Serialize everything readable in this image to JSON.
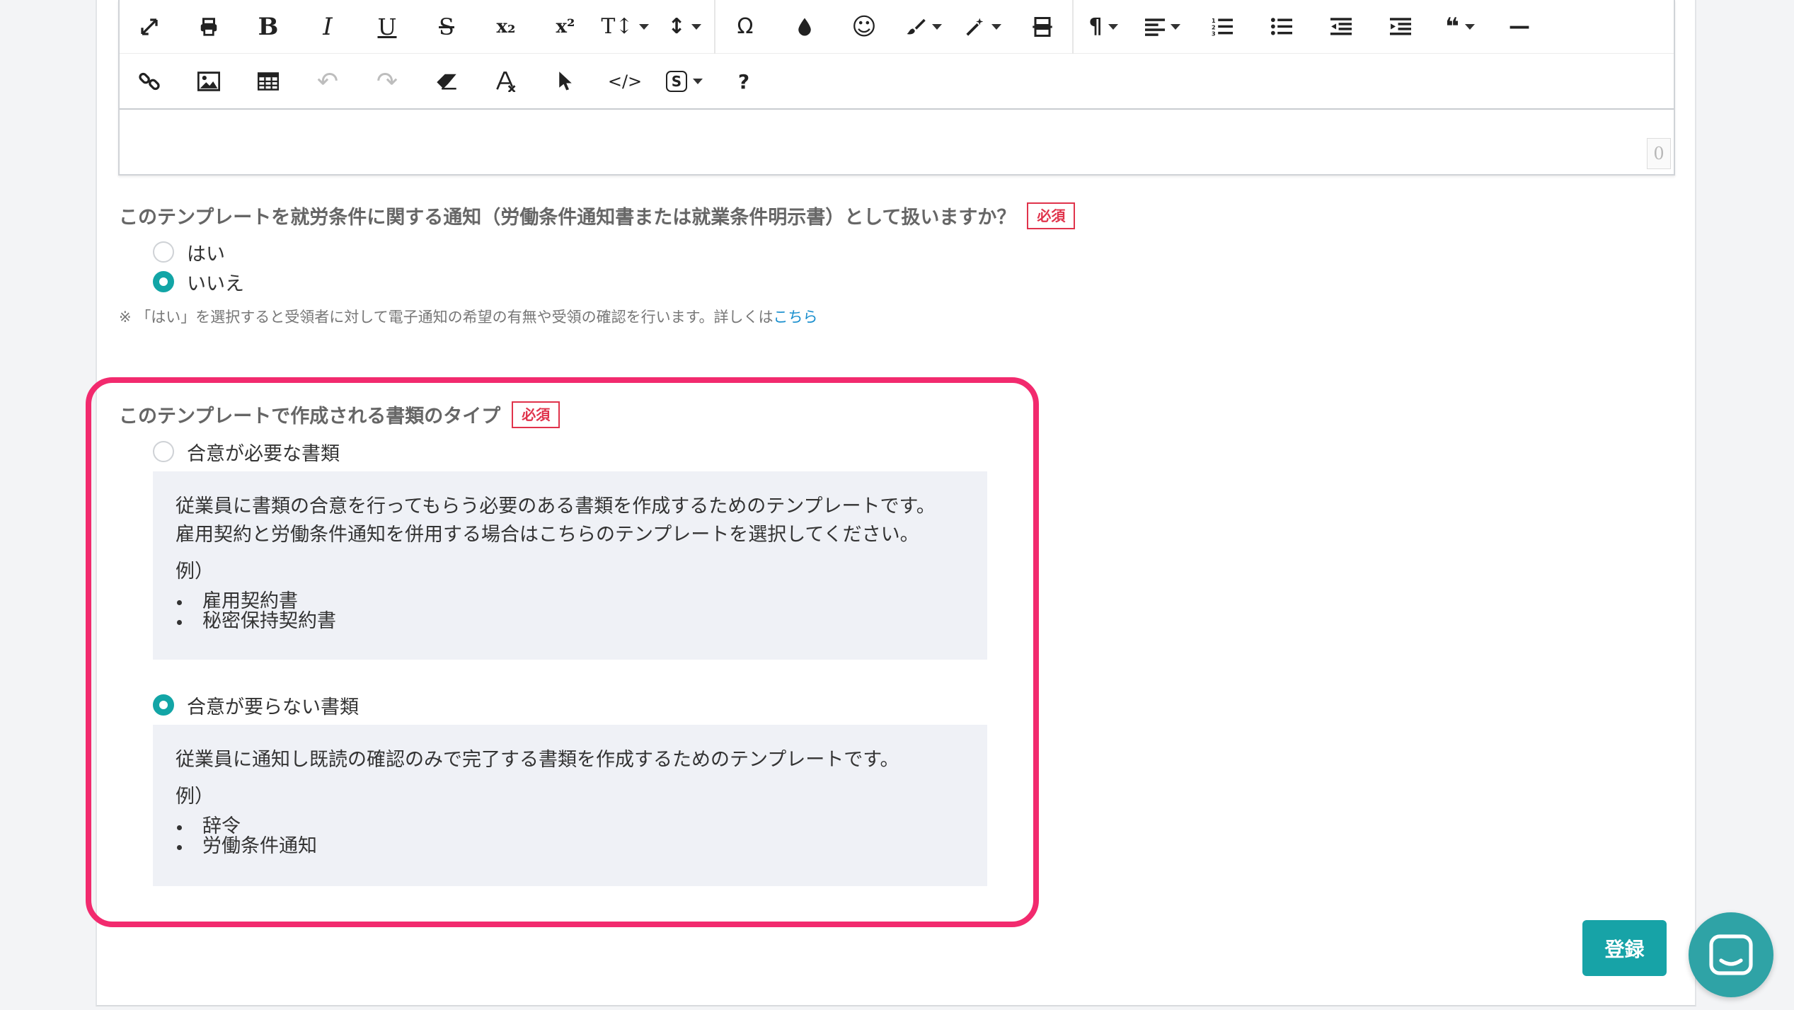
{
  "toolbar": {
    "row1": [
      {
        "icon": "fullscreen-icon"
      },
      {
        "icon": "print-icon"
      },
      {
        "icon": "bold-icon",
        "glyph": "B"
      },
      {
        "icon": "italic-icon",
        "glyph": "I"
      },
      {
        "icon": "underline-icon",
        "glyph": "U"
      },
      {
        "icon": "strikethrough-icon",
        "glyph": "S"
      },
      {
        "icon": "subscript-icon",
        "glyph": "x₂"
      },
      {
        "icon": "superscript-icon",
        "glyph": "x²"
      },
      {
        "icon": "font-size-icon",
        "glyph": "T↕"
      },
      {
        "icon": "line-height-icon",
        "glyph": "↕"
      },
      {
        "icon": "special-characters-icon",
        "glyph": "Ω"
      },
      {
        "icon": "text-color-icon"
      },
      {
        "icon": "emoticons-icon",
        "glyph": "☺"
      },
      {
        "icon": "paint-brush-icon"
      },
      {
        "icon": "magic-wand-icon"
      },
      {
        "icon": "page-break-icon"
      },
      {
        "icon": "paragraph-format-icon",
        "glyph": "¶"
      },
      {
        "icon": "align-icon"
      },
      {
        "icon": "ordered-list-icon"
      },
      {
        "icon": "unordered-list-icon"
      },
      {
        "icon": "outdent-icon"
      },
      {
        "icon": "indent-icon"
      },
      {
        "icon": "quote-icon",
        "glyph": "❝"
      },
      {
        "icon": "horizontal-line-icon",
        "glyph": "—"
      }
    ],
    "row2": [
      {
        "icon": "link-icon"
      },
      {
        "icon": "image-icon"
      },
      {
        "icon": "table-icon"
      },
      {
        "icon": "undo-icon",
        "glyph": "↶"
      },
      {
        "icon": "redo-icon",
        "glyph": "↷"
      },
      {
        "icon": "eraser-icon"
      },
      {
        "icon": "clear-formatting-icon"
      },
      {
        "icon": "select-all-icon"
      },
      {
        "icon": "code-view-icon",
        "glyph": "</>"
      },
      {
        "icon": "template-variables-icon",
        "glyph": "S"
      },
      {
        "icon": "help-icon",
        "glyph": "?"
      }
    ],
    "char_count": "0"
  },
  "question1": {
    "label": "このテンプレートを就労条件に関する通知（労働条件通知書または就業条件明示書）として扱いますか？",
    "required": "必須",
    "options": [
      "はい",
      "いいえ"
    ],
    "selected": "いいえ",
    "note_text": "※ 「はい」を選択すると受領者に対して電子通知の希望の有無や受領の確認を行います。詳しくは",
    "note_link": "こちら"
  },
  "question2": {
    "label": "このテンプレートで作成される書類のタイプ",
    "required": "必須",
    "options": [
      {
        "label": "合意が必要な書類",
        "selected": false,
        "desc_lines": [
          "従業員に書類の合意を行ってもらう必要のある書類を作成するためのテンプレートです。",
          "雇用契約と労働条件通知を併用する場合はこちらのテンプレートを選択してください。"
        ],
        "example_label": "例）",
        "examples": [
          "雇用契約書",
          "秘密保持契約書"
        ]
      },
      {
        "label": "合意が要らない書類",
        "selected": true,
        "desc_lines": [
          "従業員に通知し既読の確認のみで完了する書類を作成するためのテンプレートです。"
        ],
        "example_label": "例）",
        "examples": [
          "辞令",
          "労働条件通知"
        ]
      }
    ]
  },
  "submit_label": "登録",
  "colors": {
    "accent": "#12a5a6",
    "required": "#e0334b",
    "highlight": "#f22a6e",
    "link": "#1a8fce"
  }
}
